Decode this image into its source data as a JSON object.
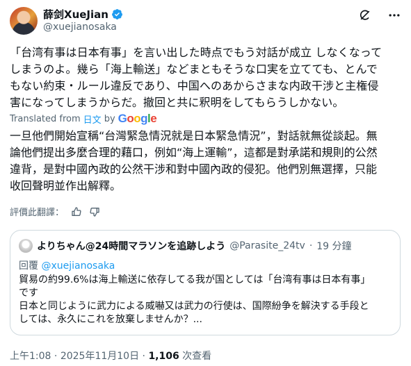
{
  "author": {
    "display_name": "薛剑XueJian",
    "handle": "@xuejianosaka"
  },
  "tweet": {
    "original_lines": [
      "「台湾有事は日本有事」を言い出した時点でもう対話が成立 しなくなって",
      "しまうのよ。幾ら「海上輸送」などまともそうな口実を立てても、とんで",
      "もない約束・ルール違反であり、中国へのあからさまな内政干涉と主権侵",
      "害になってしまうからだ。撤回と共に釈明をしてもらうしかない。"
    ],
    "translated_prefix": "Translated from ",
    "translated_lang": "日文",
    "translated_by": "by",
    "google_letters": [
      "G",
      "o",
      "o",
      "g",
      "l",
      "e"
    ],
    "translated_lines": [
      "一旦他們開始宣稱“台灣緊急情況就是日本緊急情況”，對話就無從談起。無",
      "論他們提出多麼合理的藉口，例如“海上運輸”，這都是對承諾和規則的公然",
      "違背，是對中國內政的公然干涉和對中國內政的侵犯。他們別無選擇，只能",
      "收回聲明並作出解釋。"
    ],
    "rate_label": "評價此翻譯："
  },
  "quote": {
    "name": "よりちゃん@24時間マラソンを追跡しよう",
    "handle": "@Parasite_24tv",
    "dot": "·",
    "time": "19 分鐘",
    "reply_prefix": "回覆 ",
    "reply_handle": "@xuejianosaka",
    "lines": [
      "貿易の約99.6%は海上輸送に依存してる我が国としては「台湾有事は日本有事」",
      "です",
      "日本と同じように武力による威嚇又は武力の行使は、国際紛争を解決する手段と",
      "しては、永久にこれを放棄しませんか？..."
    ]
  },
  "meta": {
    "time": "上午1:08",
    "dot1": " · ",
    "date": "2025年11月10日",
    "dot2": " · ",
    "views": "1,106",
    "views_label": " 次查看"
  },
  "colors": {
    "accent": "#1d9bf0",
    "secondary_text": "#536471",
    "border": "#cfd9de"
  }
}
